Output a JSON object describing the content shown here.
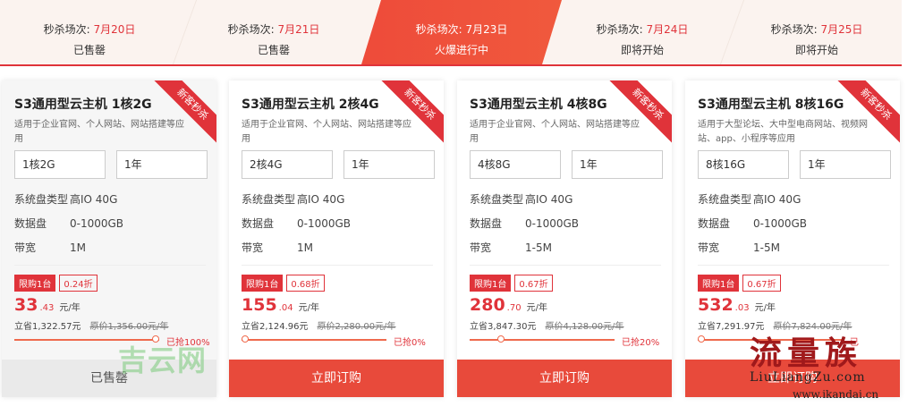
{
  "sessions": [
    {
      "label": "秒杀场次:",
      "date": "7月20日",
      "status": "已售罄"
    },
    {
      "label": "秒杀场次:",
      "date": "7月21日",
      "status": "已售罄"
    },
    {
      "label": "秒杀场次:",
      "date": "7月23日",
      "status": "火爆进行中"
    },
    {
      "label": "秒杀场次:",
      "date": "7月24日",
      "status": "即将开始"
    },
    {
      "label": "秒杀场次:",
      "date": "7月25日",
      "status": "即将开始"
    }
  ],
  "cards": [
    {
      "title": "S3通用型云主机 1核2G",
      "subtitle": "适用于企业官网、个人网站、网站搭建等应用",
      "ribbon": "新客秒杀",
      "config": "1核2G",
      "period": "1年",
      "disk_type_label": "系统盘类型",
      "disk_type": "高IO 40G",
      "data_disk_label": "数据盘",
      "data_disk": "0-1000GB",
      "bandwidth_label": "带宽",
      "bandwidth": "1M",
      "limit": "限购1台",
      "discount": "0.24折",
      "price_int": "33",
      "price_dec": ".43",
      "price_unit": "元/年",
      "save": "立省1,322.57元",
      "orig": "原价1,356.00元/年",
      "progress_fraction": 1.0,
      "progress_text": "已抢100%",
      "action": "已售罄",
      "state": "sold"
    },
    {
      "title": "S3通用型云主机 2核4G",
      "subtitle": "适用于企业官网、个人网站、网站搭建等应用",
      "ribbon": "新客秒杀",
      "config": "2核4G",
      "period": "1年",
      "disk_type_label": "系统盘类型",
      "disk_type": "高IO 40G",
      "data_disk_label": "数据盘",
      "data_disk": "0-1000GB",
      "bandwidth_label": "带宽",
      "bandwidth": "1M",
      "limit": "限购1台",
      "discount": "0.68折",
      "price_int": "155",
      "price_dec": ".04",
      "price_unit": "元/年",
      "save": "立省2,124.96元",
      "orig": "原价2,280.00元/年",
      "progress_fraction": 0.0,
      "progress_text": "已抢0%",
      "action": "立即订购",
      "state": "buy"
    },
    {
      "title": "S3通用型云主机 4核8G",
      "subtitle": "适用于企业官网、个人网站、网站搭建等应用",
      "ribbon": "新客秒杀",
      "config": "4核8G",
      "period": "1年",
      "disk_type_label": "系统盘类型",
      "disk_type": "高IO 40G",
      "data_disk_label": "数据盘",
      "data_disk": "0-1000GB",
      "bandwidth_label": "带宽",
      "bandwidth": "1-5M",
      "limit": "限购1台",
      "discount": "0.67折",
      "price_int": "280",
      "price_dec": ".70",
      "price_unit": "元/年",
      "save": "立省3,847.30元",
      "orig": "原价4,128.00元/年",
      "progress_fraction": 0.2,
      "progress_text": "已抢20%",
      "action": "立即订购",
      "state": "buy"
    },
    {
      "title": "S3通用型云主机 8核16G",
      "subtitle": "适用于大型论坛、大中型电商网站、视频网站、app、小程序等应用",
      "ribbon": "新客秒杀",
      "config": "8核16G",
      "period": "1年",
      "disk_type_label": "系统盘类型",
      "disk_type": "高IO 40G",
      "data_disk_label": "数据盘",
      "data_disk": "0-1000GB",
      "bandwidth_label": "带宽",
      "bandwidth": "1-5M",
      "limit": "限购1台",
      "discount": "0.67折",
      "price_int": "532",
      "price_dec": ".03",
      "price_unit": "元/年",
      "save": "立省7,291.97元",
      "orig": "原价7,824.00元/年",
      "progress_fraction": 0.0,
      "progress_text": "已",
      "action": "立即订购",
      "state": "buy"
    }
  ],
  "watermarks": {
    "jiyun": "吉云网",
    "liuliang_cn": "流量族",
    "liuliang_en": "LiuLiangZu.com",
    "site": "www.ikandai.cn"
  },
  "colors": {
    "accent": "#e0333a",
    "button": "#e84a3b",
    "tab_bg": "#fbf3ef"
  }
}
